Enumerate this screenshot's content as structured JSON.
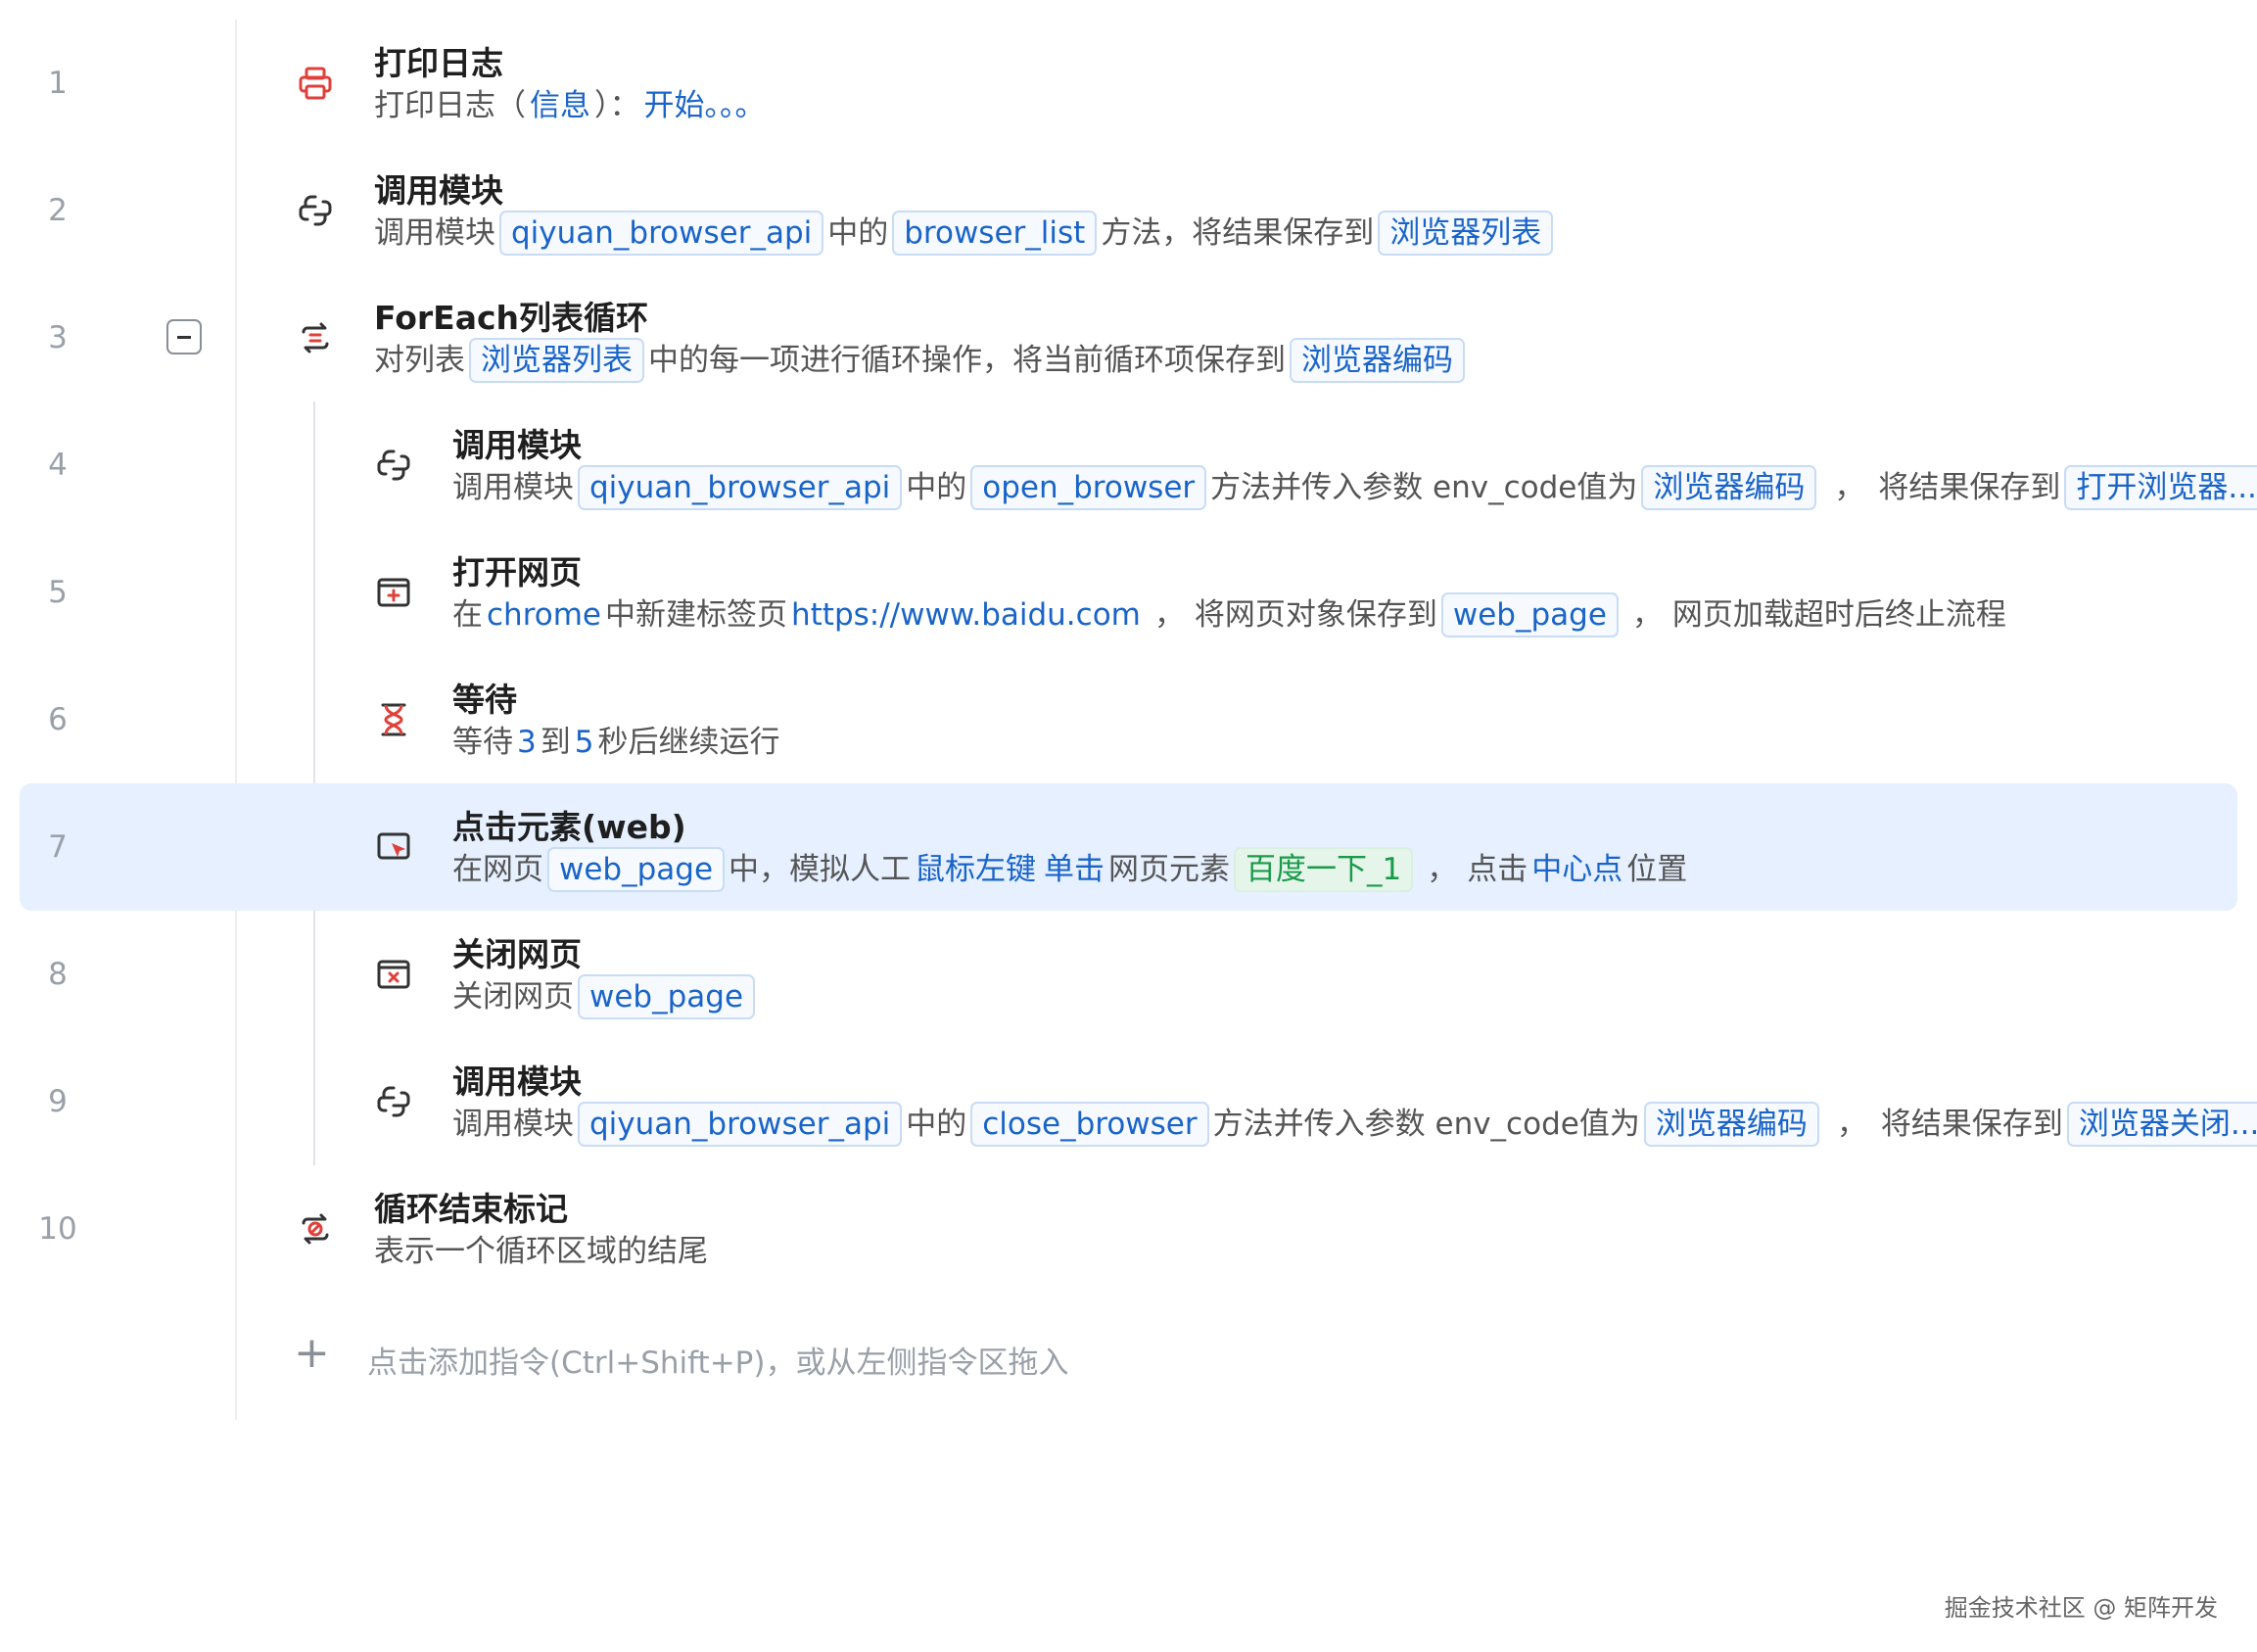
{
  "add_hint": "点击添加指令(Ctrl+Shift+P)，或从左侧指令区拖入",
  "watermark": "掘金技术社区 @ 矩阵开发",
  "steps": [
    {
      "num": "1",
      "title": "打印日志",
      "d": [
        "打印日志（",
        "信息",
        "）：",
        "开始。。。"
      ]
    },
    {
      "num": "2",
      "title": "调用模块",
      "d": [
        "调用模块",
        "qiyuan_browser_api",
        "中的",
        "browser_list",
        "方法，将结果保存到",
        "浏览器列表"
      ]
    },
    {
      "num": "3",
      "title": "ForEach列表循环",
      "d": [
        "对列表",
        "浏览器列表",
        "中的每一项进行循环操作，将当前循环项保存到",
        "浏览器编码"
      ]
    },
    {
      "num": "4",
      "title": "调用模块",
      "d": [
        "调用模块",
        "qiyuan_browser_api",
        "中的",
        "open_browser",
        "方法并传入参数 env_code值为",
        "浏览器编码",
        "，",
        "将结果保存到",
        "打开浏览器..."
      ]
    },
    {
      "num": "5",
      "title": "打开网页",
      "d": [
        "在",
        "chrome",
        "中新建标签页",
        "https://www.baidu.com",
        "，",
        "将网页对象保存到",
        "web_page",
        "，",
        "网页加载超时后终止流程"
      ]
    },
    {
      "num": "6",
      "title": "等待",
      "d": [
        "等待",
        "3",
        "到",
        "5",
        "秒后继续运行"
      ]
    },
    {
      "num": "7",
      "title": "点击元素(web)",
      "d": [
        "在网页",
        "web_page",
        "中，模拟人工",
        "鼠标左键",
        "单击",
        "网页元素",
        "百度一下_1",
        "，",
        "点击",
        "中心点",
        "位置"
      ]
    },
    {
      "num": "8",
      "title": "关闭网页",
      "d": [
        "关闭网页",
        "web_page"
      ]
    },
    {
      "num": "9",
      "title": "调用模块",
      "d": [
        "调用模块",
        "qiyuan_browser_api",
        "中的",
        "close_browser",
        "方法并传入参数 env_code值为",
        "浏览器编码",
        "，",
        "将结果保存到",
        "浏览器关闭..."
      ]
    },
    {
      "num": "10",
      "title": "循环结束标记",
      "d": [
        "表示一个循环区域的结尾"
      ]
    }
  ]
}
